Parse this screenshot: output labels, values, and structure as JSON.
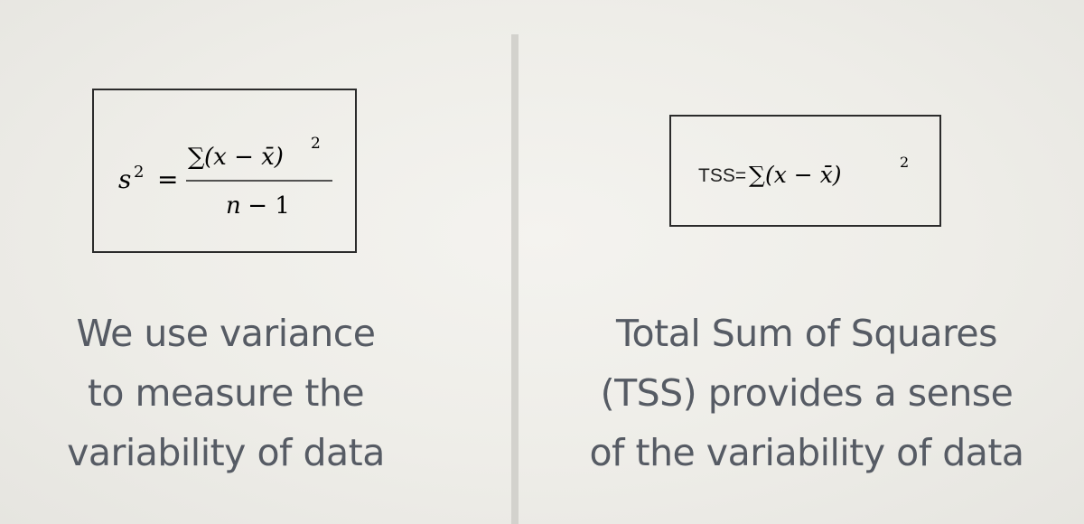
{
  "left": {
    "formula": {
      "lhs_var": "s",
      "lhs_exp": "2",
      "equals": "=",
      "num_sigma": "∑",
      "num_body": "(x − x̄)",
      "num_exp": "2",
      "den_var": "n",
      "den_rest": " − 1"
    },
    "caption": [
      "We use variance",
      "to measure the",
      "variability of data"
    ]
  },
  "right": {
    "formula": {
      "label": "TSS=",
      "sigma": "∑",
      "body": "(x − x̄)",
      "exp": "2"
    },
    "caption": [
      "Total Sum of Squares",
      "(TSS) provides a sense",
      "of the variability of data"
    ]
  }
}
